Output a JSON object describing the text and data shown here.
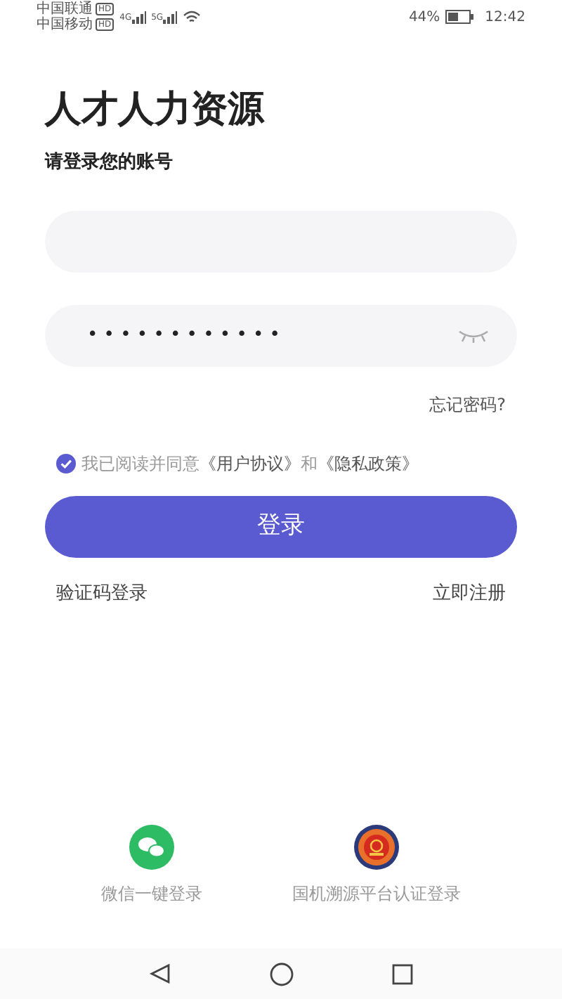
{
  "status_bar": {
    "carriers": [
      {
        "name": "中国联通",
        "badge": "HD"
      },
      {
        "name": "中国移动",
        "badge": "HD"
      }
    ],
    "signals": [
      "4G",
      "5G"
    ],
    "battery_percent": "44%",
    "time": "12:42"
  },
  "title": "人才人力资源",
  "subtitle": "请登录您的账号",
  "password_field": {
    "value": "• • • • • • • • • • • •",
    "visible": false
  },
  "forgot_password": "忘记密码?",
  "agreement": {
    "checked": true,
    "parts": [
      {
        "kind": "plain",
        "text": "我已阅读并同意"
      },
      {
        "kind": "link",
        "text": "《用户协议》"
      },
      {
        "kind": "plain",
        "text": "和"
      },
      {
        "kind": "link",
        "text": "《隐私政策》"
      }
    ]
  },
  "login_button": "登录",
  "links": [
    "验证码登录",
    "立即注册"
  ],
  "third_party": [
    {
      "kind": "wechat",
      "label": "微信一键登录"
    },
    {
      "kind": "emblem",
      "label": "国机溯源平台认证登录"
    }
  ]
}
